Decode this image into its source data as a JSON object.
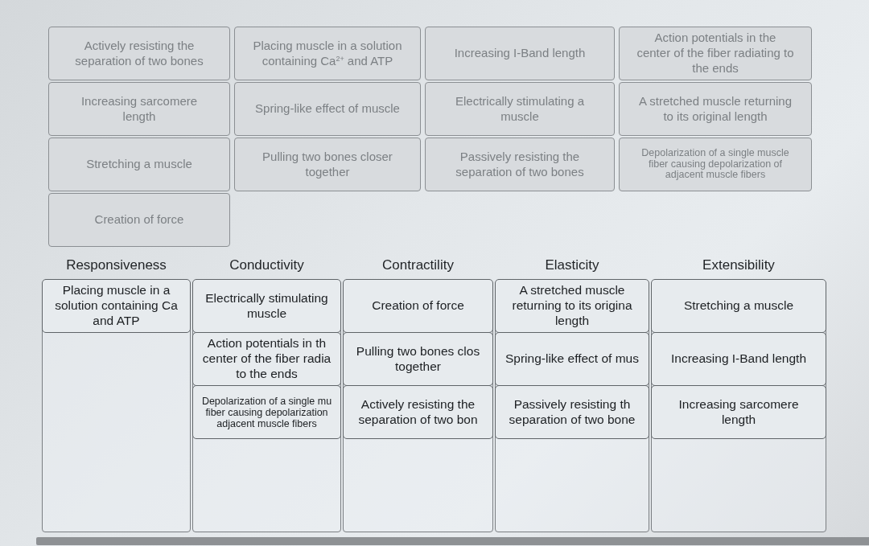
{
  "answer_bank": {
    "tiles": [
      {
        "text": "Actively resisting the\nseparation of two bones",
        "disabled": true
      },
      {
        "text": "Placing muscle in a solution\ncontaining Ca$^{2+}$ and ATP",
        "disabled": true
      },
      {
        "text": "Increasing I-Band length",
        "disabled": true
      },
      {
        "text": "Action potentials in the\ncenter of the fiber radiating to\nthe ends",
        "disabled": true
      },
      {
        "text": "Increasing sarcomere\nlength",
        "disabled": true
      },
      {
        "text": "Spring-like effect of muscle",
        "disabled": true
      },
      {
        "text": "Electrically stimulating a\nmuscle",
        "disabled": true
      },
      {
        "text": "A stretched muscle returning\nto its original length",
        "disabled": true
      },
      {
        "text": "Stretching a muscle",
        "disabled": true
      },
      {
        "text": "Pulling two bones closer\ntogether",
        "disabled": true
      },
      {
        "text": "Passively resisting the\nseparation of two bones",
        "disabled": true
      },
      {
        "text": "Depolarization of a single muscle\nfiber causing depolarization of\nadjacent muscle fibers",
        "disabled": true
      },
      {
        "text": "Creation of force",
        "disabled": true
      }
    ]
  },
  "categories": [
    {
      "heading": "Responsiveness",
      "tiles": [
        "Placing muscle in a\nsolution containing Ca\nand ATP"
      ]
    },
    {
      "heading": "Conductivity",
      "tiles": [
        "Electrically stimulating\nmuscle",
        "Action potentials in th\ncenter of the fiber radia\nto the ends",
        "Depolarization of a single mu\nfiber causing depolarization\nadjacent muscle fibers"
      ]
    },
    {
      "heading": "Contractility",
      "tiles": [
        "Creation of force",
        "Pulling two bones clos\ntogether",
        "Actively resisting the\nseparation of two bon"
      ]
    },
    {
      "heading": "Elasticity",
      "tiles": [
        "A stretched muscle\nreturning to its origina\nlength",
        "Spring-like effect of mus",
        "Passively resisting th\nseparation of two bone"
      ]
    },
    {
      "heading": "Extensibility",
      "tiles": [
        "Stretching a muscle",
        "Increasing I-Band length",
        "Increasing sarcomere\nlength"
      ]
    }
  ]
}
